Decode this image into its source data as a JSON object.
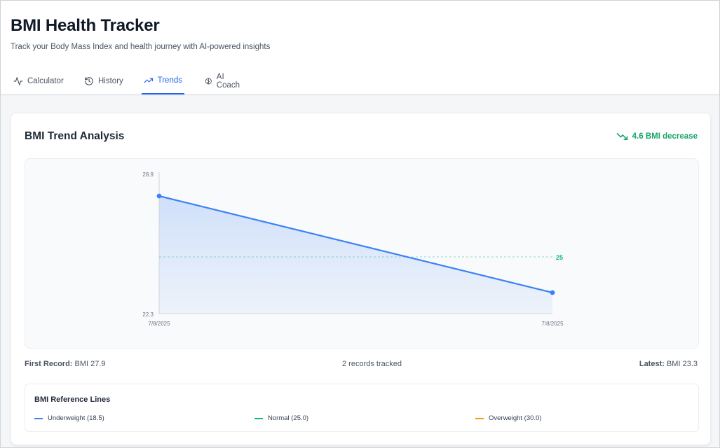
{
  "app": {
    "title": "BMI Health Tracker",
    "subtitle": "Track your Body Mass Index and health journey with AI-powered insights"
  },
  "tabs": [
    {
      "label": "Calculator",
      "icon": "pulse-icon",
      "active": false
    },
    {
      "label": "History",
      "icon": "history-icon",
      "active": false
    },
    {
      "label": "Trends",
      "icon": "trending-up-icon",
      "active": true
    },
    {
      "label": "AI Coach",
      "icon": "brain-icon",
      "active": false
    }
  ],
  "card": {
    "title": "BMI Trend Analysis",
    "trend_badge": "4.6 BMI decrease",
    "trend_icon": "trending-down-icon"
  },
  "chart_data": {
    "type": "area",
    "x": [
      "7/8/2025",
      "7/8/2025"
    ],
    "values": [
      27.9,
      23.3
    ],
    "ylim": [
      22.3,
      28.9
    ],
    "y_tick_labels": [
      "28.9",
      "22.3"
    ],
    "reference_line": {
      "value": 25,
      "label": "25",
      "color": "#10b981"
    },
    "series_color": "#3b82f6",
    "xlabel": "",
    "ylabel": ""
  },
  "summary": {
    "first_label": "First Record:",
    "first_value": "BMI 27.9",
    "records": "2 records tracked",
    "latest_label": "Latest:",
    "latest_value": "BMI 23.3"
  },
  "reference_lines": {
    "title": "BMI Reference Lines",
    "items": [
      {
        "label": "Underweight (18.5)",
        "color": "#3b82f6"
      },
      {
        "label": "Normal (25.0)",
        "color": "#10b981"
      },
      {
        "label": "Overweight (30.0)",
        "color": "#f59e0b"
      }
    ]
  },
  "colors": {
    "accent": "#2563eb",
    "positive": "#16a36a"
  }
}
